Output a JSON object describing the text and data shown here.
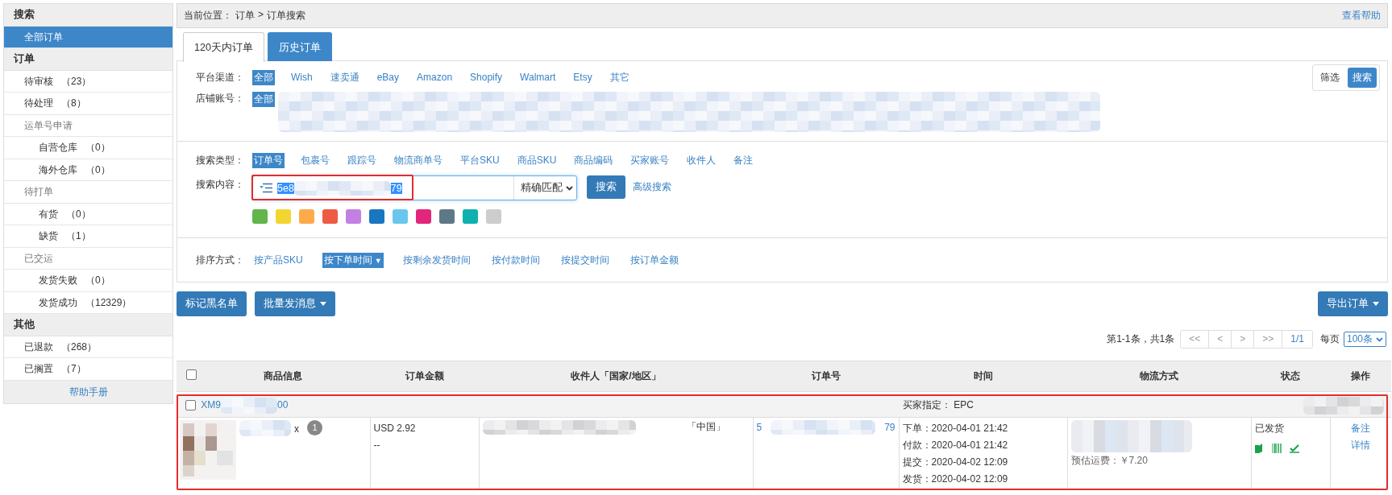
{
  "sidebar": {
    "sections": [
      {
        "title": "搜索",
        "items": [
          {
            "label": "全部订单",
            "selected": true
          }
        ]
      },
      {
        "title": "订单",
        "items": [
          {
            "label": "待审核",
            "count": "（23）",
            "selected": false
          },
          {
            "label": "待处理",
            "count": "（8）",
            "selected": false
          },
          {
            "label": "运单号申请",
            "selected": false,
            "children": [
              {
                "label": "自营仓库",
                "count": "（0）",
                "selected": false
              },
              {
                "label": "海外仓库",
                "count": "（0）",
                "selected": false
              }
            ]
          },
          {
            "label": "待打单",
            "selected": false,
            "children": [
              {
                "label": "有货",
                "count": "（0）",
                "selected": false
              },
              {
                "label": "缺货",
                "count": "（1）",
                "selected": false
              }
            ]
          },
          {
            "label": "已交运",
            "selected": false,
            "children": [
              {
                "label": "发货失败",
                "count": "（0）",
                "selected": false
              },
              {
                "label": "发货成功",
                "count": "（12329）",
                "selected": false
              }
            ]
          }
        ]
      },
      {
        "title": "其他",
        "items": [
          {
            "label": "已退款",
            "count": "（268）",
            "selected": false
          },
          {
            "label": "已搁置",
            "count": "（7）",
            "selected": false
          }
        ]
      }
    ],
    "help_link": "帮助手册"
  },
  "breadcrumb": {
    "location": "当前位置：",
    "crumbs": [
      "订单",
      "订单搜索"
    ],
    "separator": ">",
    "help": "查看帮助"
  },
  "tabs": [
    {
      "label": "120天内订单",
      "selected": true
    },
    {
      "label": "历史订单",
      "selected": false
    }
  ],
  "filters": {
    "platform": {
      "label": "平台渠道：",
      "options": [
        {
          "label": "全部",
          "selected": true
        },
        {
          "label": "Wish",
          "selected": false
        },
        {
          "label": "速卖通",
          "selected": false
        },
        {
          "label": "eBay",
          "selected": false
        },
        {
          "label": "Amazon",
          "selected": false
        },
        {
          "label": "Shopify",
          "selected": false
        },
        {
          "label": "Walmart",
          "selected": false
        },
        {
          "label": "Etsy",
          "selected": false
        },
        {
          "label": "其它",
          "selected": false
        }
      ]
    },
    "store": {
      "label": "店铺账号：",
      "options": [
        {
          "label": "全部",
          "selected": true
        }
      ],
      "blurred": true
    },
    "mode": [
      {
        "label": "筛选",
        "selected": false
      },
      {
        "label": "搜索",
        "selected": true
      }
    ]
  },
  "search": {
    "type": {
      "label": "搜索类型：",
      "options": [
        {
          "label": "订单号",
          "selected": true
        },
        {
          "label": "包裹号",
          "selected": false
        },
        {
          "label": "跟踪号",
          "selected": false
        },
        {
          "label": "物流商单号",
          "selected": false
        },
        {
          "label": "平台SKU",
          "selected": false
        },
        {
          "label": "商品SKU",
          "selected": false
        },
        {
          "label": "商品编码",
          "selected": false
        },
        {
          "label": "买家账号",
          "selected": false
        },
        {
          "label": "收件人",
          "selected": false
        },
        {
          "label": "备注",
          "selected": false
        }
      ]
    },
    "content": {
      "label": "搜索内容：",
      "value_start": "5e8",
      "value_end": "79",
      "blurred": true,
      "highlighted": true,
      "match": "精确匹配",
      "button": "搜索",
      "advanced": "高级搜索"
    },
    "colors": [
      {
        "color": "#62b549"
      },
      {
        "color": "#f2d531"
      },
      {
        "color": "#ffaa4a"
      },
      {
        "color": "#ee5b44"
      },
      {
        "color": "#c47fe3"
      },
      {
        "color": "#1877bf"
      },
      {
        "color": "#69c7ef"
      },
      {
        "color": "#e2267c"
      },
      {
        "color": "#5f7887"
      },
      {
        "color": "#0fb1b0"
      },
      {
        "color": "#cdcdcd"
      }
    ]
  },
  "sort": {
    "label": "排序方式：",
    "options": [
      {
        "label": "按产品SKU",
        "selected": false
      },
      {
        "label": "按下单时间",
        "selected": true,
        "direction": "▼"
      },
      {
        "label": "按剩余发货时间",
        "selected": false
      },
      {
        "label": "按付款时间",
        "selected": false
      },
      {
        "label": "按提交时间",
        "selected": false
      },
      {
        "label": "按订单金额",
        "selected": false
      }
    ]
  },
  "actions": [
    {
      "label": "标记黑名单",
      "dropdown": false
    },
    {
      "label": "批量发消息",
      "dropdown": true
    }
  ],
  "export": {
    "label": "导出订单",
    "dropdown": true
  },
  "pagination": {
    "summary": "第1-1条，共1条",
    "buttons": [
      "<<",
      "<",
      ">",
      ">>"
    ],
    "page": "1/1",
    "per_page_label": "每页",
    "per_page": "100条"
  },
  "table": {
    "columns": [
      "商品信息",
      "订单金额",
      "收件人「国家/地区」",
      "订单号",
      "时间",
      "物流方式",
      "状态",
      "操作"
    ],
    "header_checked": false,
    "orders": [
      {
        "checked": false,
        "highlighted": true,
        "id_start": "XM9",
        "id_end": "00",
        "id_blurred": true,
        "buyer_choice": "买家指定： EPC",
        "aside_blurred": true,
        "product": {
          "kind": "picture",
          "blurred": true,
          "quantity_label": "x",
          "quantity": "1"
        },
        "amount": "USD 2.92",
        "amount_note": "--",
        "recipient_blurred": true,
        "country": "「中国」",
        "order_no_start": "5",
        "order_no_end": "79",
        "order_no_blurred": true,
        "times": [
          "下单：2020-04-01 21:42",
          "付款：2020-04-01 21:42",
          "提交：2020-04-02 12:09",
          "发货：2020-04-02 12:09"
        ],
        "shipping_blurred": true,
        "shipping_fee": "预估运费：￥7.20",
        "status": "已发货",
        "operations": [
          "备注",
          "详情"
        ]
      }
    ]
  }
}
